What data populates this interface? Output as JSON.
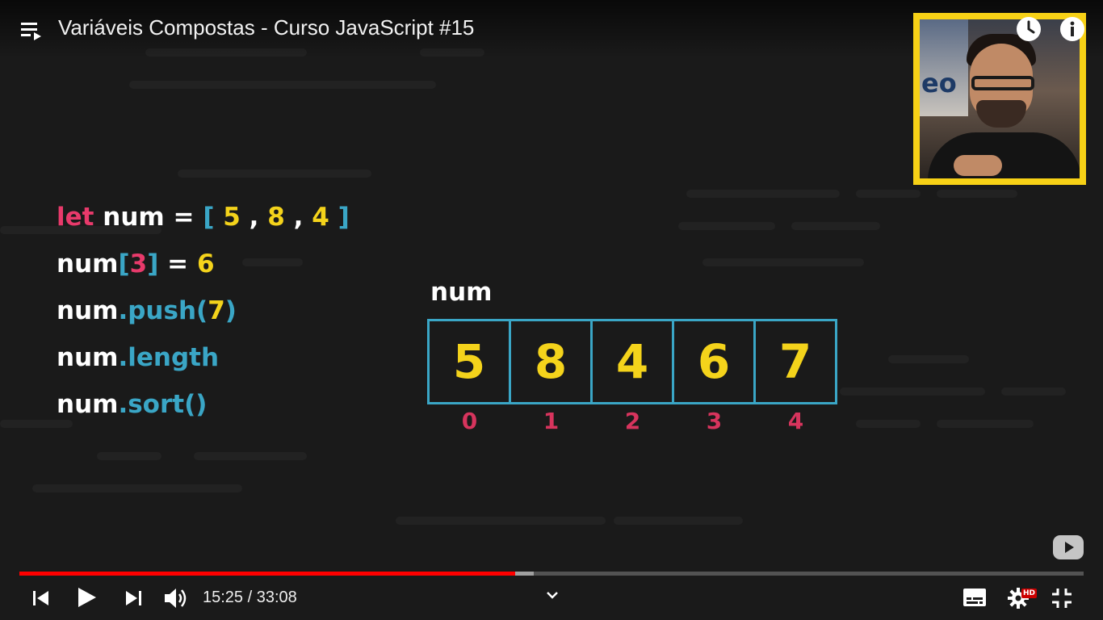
{
  "video": {
    "title": "Variáveis Compostas - Curso JavaScript #15"
  },
  "code_lines": {
    "line1": {
      "kw": "let",
      "name": "num",
      "eq": "=",
      "open": "[",
      "v1": "5",
      "sep1": ",",
      "v2": "8",
      "sep2": ",",
      "v3": "4",
      "close": "]"
    },
    "line2": {
      "name": "num",
      "open": "[",
      "idx": "3",
      "close": "]",
      "eq": "=",
      "val": "6"
    },
    "line3": {
      "name": "num",
      "method": ".push(",
      "arg": "7",
      "close": ")"
    },
    "line4": {
      "name": "num",
      "method": ".length"
    },
    "line5": {
      "name": "num",
      "method": ".sort()"
    }
  },
  "array_viz": {
    "label": "num",
    "values": [
      "5",
      "8",
      "4",
      "6",
      "7"
    ],
    "indices": [
      "0",
      "1",
      "2",
      "3",
      "4"
    ]
  },
  "player": {
    "current_time": "15:25",
    "separator": " / ",
    "duration": "33:08",
    "played_fraction": 0.466,
    "loaded_fraction": 0.483,
    "quality_badge": "HD"
  },
  "icons": {
    "playlist": "playlist-icon",
    "watch_later": "clock-icon",
    "info": "info-icon",
    "prev": "previous-icon",
    "play": "play-icon",
    "next": "next-icon",
    "volume": "volume-icon",
    "chevron": "chevron-down-icon",
    "subtitles": "subtitles-icon",
    "settings": "gear-icon",
    "exit_fullscreen": "exit-fullscreen-icon",
    "logo": "youtube-logo-icon"
  },
  "colors": {
    "keyword": "#e83a6b",
    "method": "#3aa6c6",
    "number": "#f4d31b",
    "index": "#d7345d",
    "progress_played": "#ff0000",
    "presenter_frame": "#f7d116"
  }
}
